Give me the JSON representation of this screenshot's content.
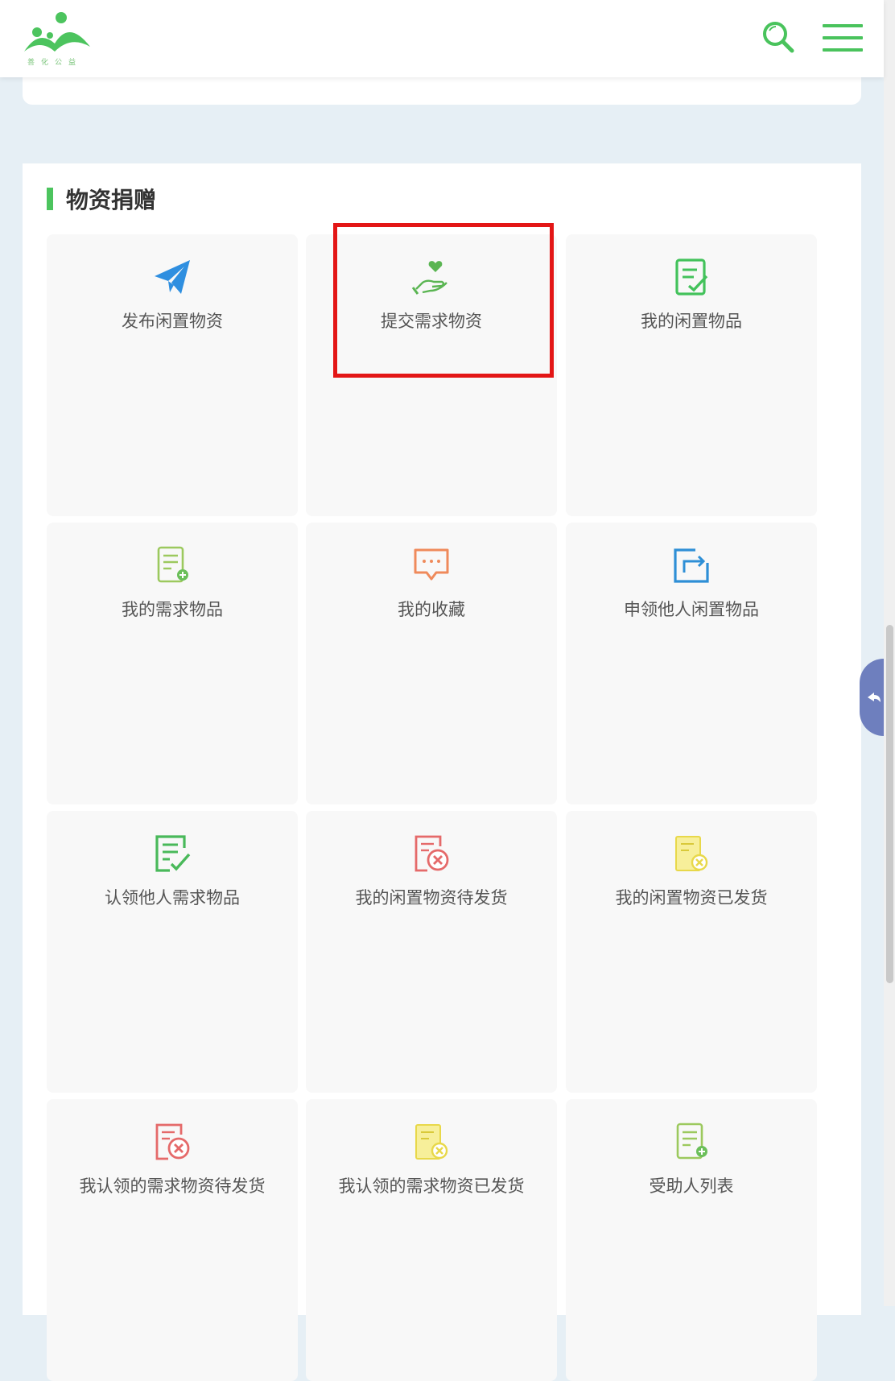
{
  "header": {
    "logo_text": "善化公益",
    "search_icon": "search-icon",
    "menu_icon": "hamburger-menu-icon"
  },
  "section": {
    "title": "物资捐赠"
  },
  "cards": [
    {
      "label": "发布闲置物资",
      "icon": "paper-plane-icon",
      "color": "#2f8fe0"
    },
    {
      "label": "提交需求物资",
      "icon": "heart-hand-icon",
      "color": "#5ab552"
    },
    {
      "label": "我的闲置物品",
      "icon": "edit-check-icon",
      "color": "#43c25b"
    },
    {
      "label": "我的需求物品",
      "icon": "document-add-icon",
      "color": "#9cc95e"
    },
    {
      "label": "我的收藏",
      "icon": "chat-bubble-icon",
      "color": "#ef8a5b"
    },
    {
      "label": "申领他人闲置物品",
      "icon": "share-box-icon",
      "color": "#2e8fd6"
    },
    {
      "label": "认领他人需求物品",
      "icon": "checklist-icon",
      "color": "#49b95a"
    },
    {
      "label": "我的闲置物资待发货",
      "icon": "document-cancel-icon",
      "color": "#e56a6a"
    },
    {
      "label": "我的闲置物资已发货",
      "icon": "document-cancel-yellow-icon",
      "color": "#e8d84a"
    },
    {
      "label": "我认领的需求物资待发货",
      "icon": "document-cancel-icon",
      "color": "#e56a6a"
    },
    {
      "label": "我认领的需求物资已发货",
      "icon": "document-cancel-yellow-icon",
      "color": "#e8d84a"
    },
    {
      "label": "受助人列表",
      "icon": "document-add-icon",
      "color": "#9cc95e"
    }
  ],
  "side": {
    "back_icon": "back-arrow-icon"
  }
}
